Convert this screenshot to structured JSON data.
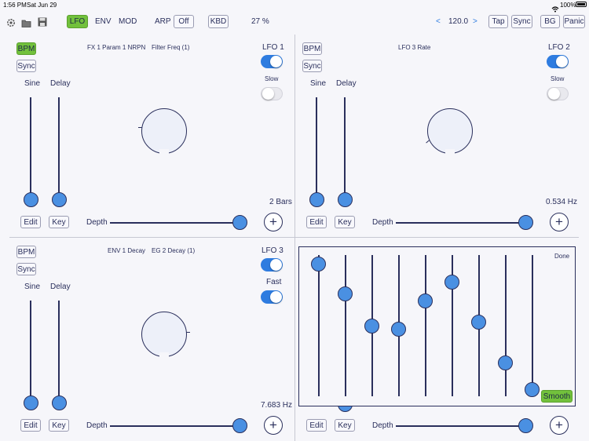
{
  "status_bar": {
    "time": "1:56 PM",
    "date": "Sat Jun 29",
    "battery": "100%"
  },
  "toolbar": {
    "tabs": [
      "LFO",
      "ENV",
      "MOD"
    ],
    "arp_label": "ARP",
    "arp_value": "Off",
    "kbd_label": "KBD",
    "percent": "27 %",
    "tempo_prev": "<",
    "tempo": "120.0",
    "tempo_next": ">",
    "tap_label": "Tap",
    "sync_label": "Sync",
    "bg_label": "BG",
    "panic_label": "Panic"
  },
  "panels": [
    {
      "bpm": "BPM",
      "sync": "Sync",
      "target1": "FX 1 Param 1 NRPN",
      "target2": "Filter Freq (1)",
      "title": "LFO 1",
      "mode_label": "Slow",
      "title_on": true,
      "mode_on": false,
      "wave": "Sine",
      "delay": "Delay",
      "value": "2 Bars",
      "edit": "Edit",
      "key": "Key",
      "depth": "Depth",
      "plus": "+",
      "depth_level": 1.0
    },
    {
      "bpm": "BPM",
      "sync": "Sync",
      "target1": "LFO 3 Rate",
      "target2": "",
      "title": "LFO 2",
      "mode_label": "Slow",
      "title_on": true,
      "mode_on": false,
      "wave": "Sine",
      "delay": "Delay",
      "value": "0.534 Hz",
      "edit": "Edit",
      "key": "Key",
      "depth": "Depth",
      "plus": "+",
      "depth_level": 1.0
    },
    {
      "bpm": "BPM",
      "sync": "Sync",
      "target1": "ENV 1 Decay",
      "target2": "EG 2 Decay (1)",
      "title": "LFO 3",
      "mode_label": "Fast",
      "title_on": true,
      "mode_on": true,
      "wave": "Sine",
      "delay": "Delay",
      "value": "7.683 Hz",
      "edit": "Edit",
      "key": "Key",
      "depth": "Depth",
      "plus": "+",
      "depth_level": 1.0
    },
    {
      "edit": "Edit",
      "key": "Key",
      "depth": "Depth",
      "plus": "+",
      "depth_level": 1.0
    }
  ],
  "step_editor": {
    "done_label": "Done",
    "smooth_label": "Smooth",
    "steps": [
      0.94,
      0.73,
      0.5,
      0.48,
      0.68,
      0.81,
      0.53,
      0.24,
      0.05
    ]
  },
  "colors": {
    "accent_green": "#72c13c",
    "toggle_blue": "#2e7ce0",
    "thumb_blue": "#4a90e2",
    "ink": "#2a2f5c"
  },
  "icons": [
    "gear-icon",
    "folder-icon",
    "save-icon",
    "wifi-icon",
    "battery-icon"
  ]
}
